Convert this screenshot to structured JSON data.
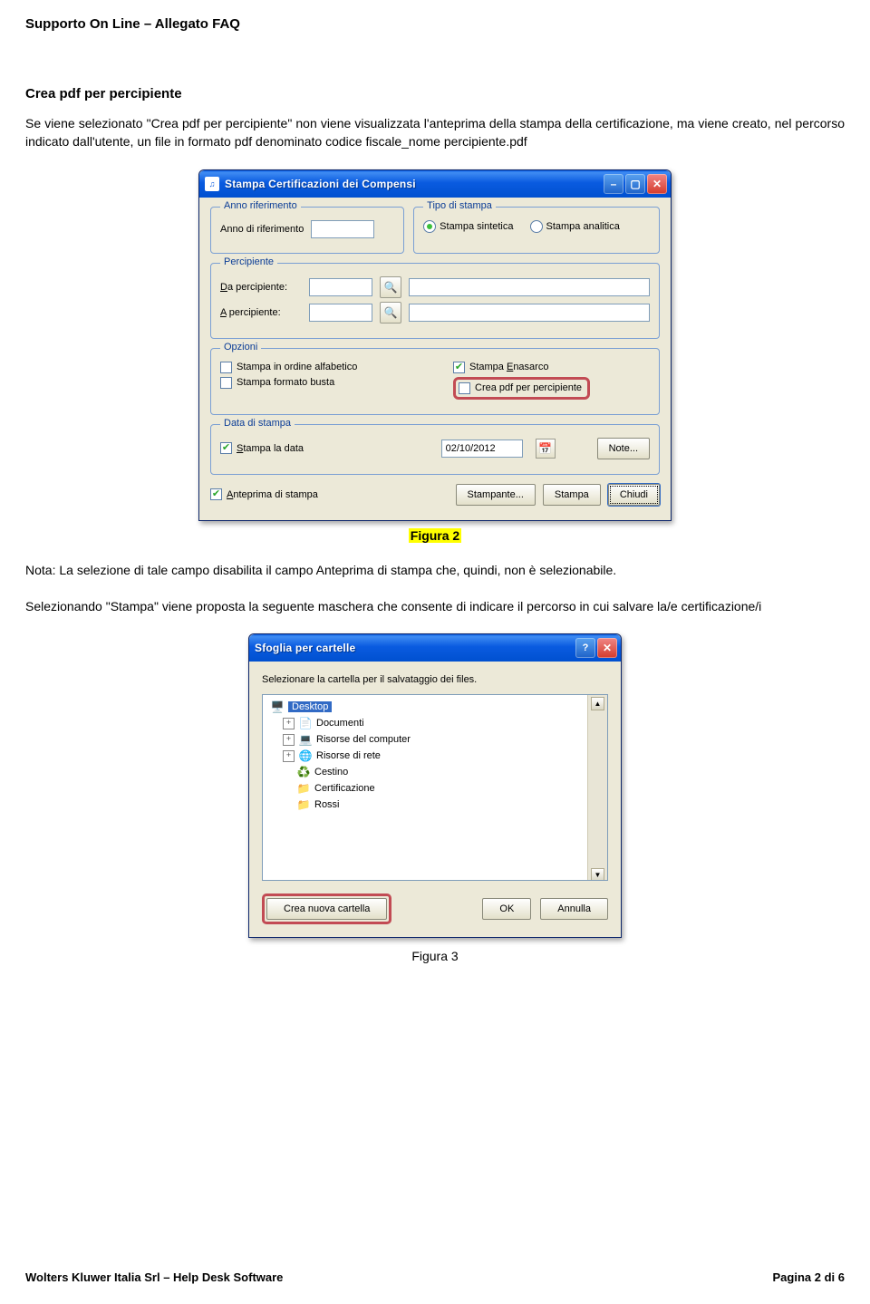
{
  "header": "Supporto On Line – Allegato FAQ",
  "section_title": "Crea pdf per percipiente",
  "para1": "Se viene selezionato \"Crea pdf per percipiente\" non viene visualizzata l'anteprima della stampa della certificazione, ma viene creato, nel percorso indicato dall'utente, un file in formato pdf denominato codice fiscale_nome percipiente.pdf",
  "para_nota": "Nota: La selezione di tale campo disabilita il campo Anteprima di stampa che, quindi, non è selezionabile.",
  "para_sel": "Selezionando \"Stampa\" viene proposta la seguente maschera che consente di indicare il percorso in cui salvare la/e certificazione/i",
  "figure2_caption": "Figura 2",
  "figure3_caption": "Figura 3",
  "dialog1": {
    "title": "Stampa Certificazioni dei Compensi",
    "grp_anno": "Anno riferimento",
    "lbl_anno": "Anno di riferimento",
    "grp_tipo": "Tipo di stampa",
    "radio_sintetica": "Stampa sintetica",
    "radio_analitica": "Stampa analitica",
    "grp_perc": "Percipiente",
    "lbl_da": "Da percipiente:",
    "lbl_a": "A percipiente:",
    "grp_opz": "Opzioni",
    "chk_alfa": "Stampa in ordine alfabetico",
    "chk_enasarco": "Stampa Enasarco",
    "chk_busta": "Stampa formato busta",
    "chk_creapdf": "Crea pdf per percipiente",
    "grp_data": "Data di stampa",
    "chk_stampa_data": "Stampa la data",
    "val_data": "02/10/2012",
    "btn_note": "Note...",
    "chk_anteprima": "Anteprima di stampa",
    "btn_stampante": "Stampante...",
    "btn_stampa": "Stampa",
    "btn_chiudi": "Chiudi"
  },
  "dialog2": {
    "title": "Sfoglia per cartelle",
    "instruction": "Selezionare la cartella per il salvataggio dei files.",
    "tree": {
      "desktop": "Desktop",
      "documenti": "Documenti",
      "risorse_computer": "Risorse del computer",
      "risorse_rete": "Risorse di rete",
      "cestino": "Cestino",
      "certificazione": "Certificazione",
      "rossi": "Rossi"
    },
    "btn_new": "Crea nuova cartella",
    "btn_ok": "OK",
    "btn_cancel": "Annulla"
  },
  "footer_left": "Wolters Kluwer Italia Srl – Help Desk Software",
  "footer_right": "Pagina 2 di 6"
}
